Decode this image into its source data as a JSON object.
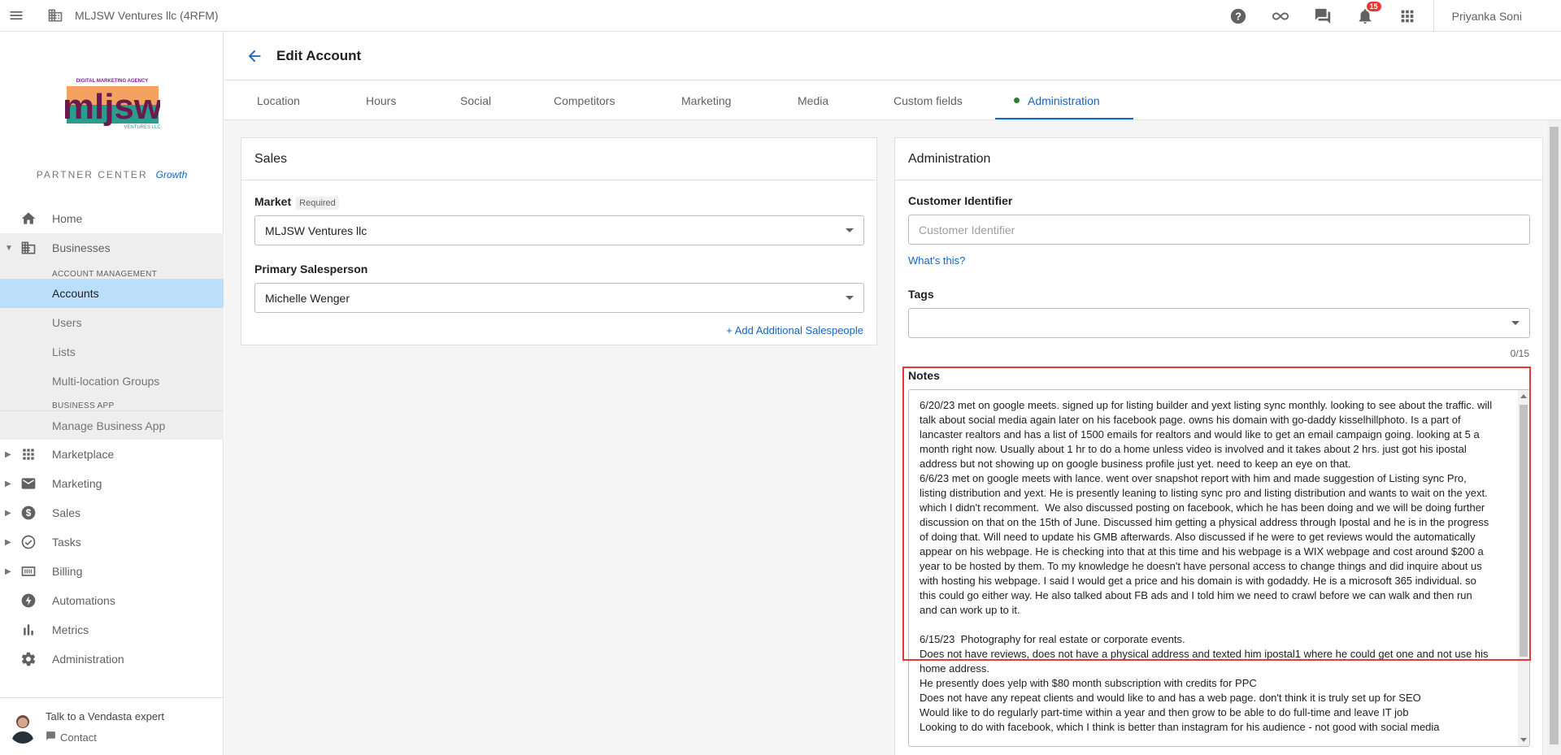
{
  "topbar": {
    "business_name": "MLJSW Ventures llc (4RFM)",
    "notification_count": "15",
    "user_name": "Priyanka Soni"
  },
  "sidebar": {
    "logo_tagline": "DIGITAL MARKETING AGENCY",
    "logo_text": "mljsw",
    "logo_subtext": "VENTURES LLC",
    "partner_center": "PARTNER CENTER",
    "plan": "Growth",
    "items": {
      "home": "Home",
      "businesses": "Businesses",
      "account_management_header": "ACCOUNT MANAGEMENT",
      "accounts": "Accounts",
      "users": "Users",
      "lists": "Lists",
      "multi_location": "Multi-location Groups",
      "business_app_header": "BUSINESS APP",
      "manage_business_app": "Manage Business App",
      "marketplace": "Marketplace",
      "marketing": "Marketing",
      "sales": "Sales",
      "tasks": "Tasks",
      "billing": "Billing",
      "automations": "Automations",
      "metrics": "Metrics",
      "administration": "Administration"
    },
    "expert": {
      "title": "Talk to a Vendasta expert",
      "contact": "Contact"
    }
  },
  "header": {
    "title": "Edit Account"
  },
  "tabs": {
    "location": "Location",
    "hours": "Hours",
    "social": "Social",
    "competitors": "Competitors",
    "marketing": "Marketing",
    "media": "Media",
    "custom_fields": "Custom fields",
    "administration": "Administration"
  },
  "sales_card": {
    "title": "Sales",
    "market_label": "Market",
    "required_tag": "Required",
    "market_value": "MLJSW Ventures llc",
    "salesperson_label": "Primary Salesperson",
    "salesperson_value": "Michelle Wenger",
    "add_salespeople": "+ Add Additional Salespeople"
  },
  "admin_card": {
    "title": "Administration",
    "customer_id_label": "Customer Identifier",
    "customer_id_placeholder": "Customer Identifier",
    "customer_id_value": "",
    "whats_this": "What's this?",
    "tags_label": "Tags",
    "tags_counter": "0/15",
    "notes_label": "Notes",
    "notes_text": "6/20/23 met on google meets. signed up for listing builder and yext listing sync monthly. looking to see about the traffic. will talk about social media again later on his facebook page. owns his domain with go-daddy kisselhillphoto. Is a part of lancaster realtors and has a list of 1500 emails for realtors and would like to get an email campaign going. looking at 5 a month right now. Usually about 1 hr to do a home unless video is involved and it takes about 2 hrs. just got his ipostal address but not showing up on google business profile just yet. need to keep an eye on that.\n6/6/23 met on google meets with lance. went over snapshot report with him and made suggestion of Listing sync Pro, listing distribution and yext. He is presently leaning to listing sync pro and listing distribution and wants to wait on the yext. which I didn't recomment.  We also discussed posting on facebook, which he has been doing and we will be doing further discussion on that on the 15th of June. Discussed him getting a physical address through Ipostal and he is in the progress of doing that. Will need to update his GMB afterwards. Also discussed if he were to get reviews would the automatically appear on his webpage. He is checking into that at this time and his webpage is a WIX webpage and cost around $200 a year to be hosted by them. To my knowledge he doesn't have personal access to change things and did inquire about us with hosting his webpage. I said I would get a price and his domain is with godaddy. He is a microsoft 365 individual. so this could go either way. He also talked about FB ads and I told him we need to crawl before we can walk and then run and can work up to it.\n\n6/15/23  Photography for real estate or corporate events.\nDoes not have reviews, does not have a physical address and texted him ipostal1 where he could get one and not use his home address.\nHe presently does yelp with $80 month subscription with credits for PPC\nDoes not have any repeat clients and would like to and has a web page. don't think it is truly set up for SEO\nWould like to do regularly part-time within a year and then grow to be able to do full-time and leave IT job\nLooking to do with facebook, which I think is better than instagram for his audience - not good with social media"
  }
}
